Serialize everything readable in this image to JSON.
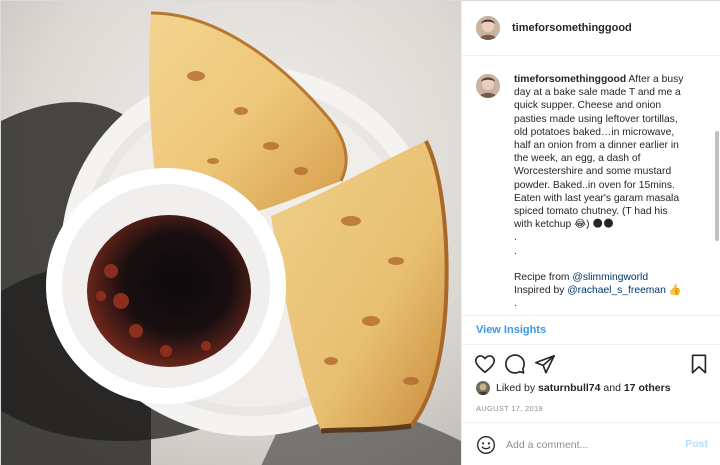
{
  "post": {
    "username": "timeforsomethinggood",
    "caption": {
      "username": "timeforsomethinggood",
      "lines": [
        "After a busy",
        "day at a bake sale made T and me a",
        "quick supper. Cheese and onion",
        "pasties made using leftover tortillas,",
        "old potatoes baked…in microwave,",
        "half an onion from a dinner earlier in",
        "the week, an egg, a dash of",
        "Worcestershire and some mustard",
        "powder. Baked..in oven for 15mins.",
        "Eaten with last year's garam masala",
        "spiced tomato chutney. (T had his",
        "with ketchup 😂) 🌑🌑",
        ".",
        ".",
        "",
        "Recipe from @slimmingworld",
        "Inspired by @rachael_s_freeman 👍",
        "."
      ]
    },
    "insights_label": "View Insights",
    "likes": {
      "prefix": "Liked by",
      "user": "saturnbull74",
      "joiner": "and",
      "others": "17 others"
    },
    "date": "AUGUST 17, 2019",
    "comment": {
      "placeholder": "Add a comment...",
      "post_label": "Post"
    },
    "icons": {
      "like": "heart-icon",
      "comment": "comment-icon",
      "share": "paper-plane-icon",
      "save": "bookmark-icon",
      "emoji": "smiley-icon"
    },
    "colors": {
      "link_blue": "#3897f0",
      "post_disabled": "#b2dffc",
      "meta_gray": "#8e8e8e"
    }
  }
}
